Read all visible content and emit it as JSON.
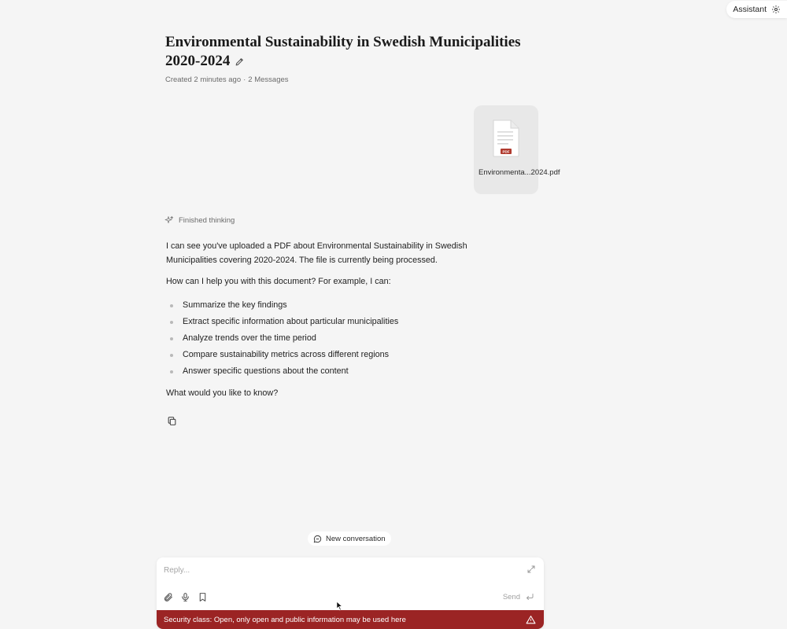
{
  "header": {
    "assistant_label": "Assistant",
    "title": "Environmental Sustainability in Swedish Municipalities 2020-2024",
    "created": "Created 2 minutes ago",
    "separator": "·",
    "messages": "2 Messages"
  },
  "attachment": {
    "filename": "Environmenta...2024.pdf",
    "badge": "PDF"
  },
  "thinking": {
    "label": "Finished thinking"
  },
  "reply": {
    "intro": "I can see you've uploaded a PDF about Environmental Sustainability in Swedish Municipalities covering 2020-2024. The file is currently being processed.",
    "question": "How can I help you with this document? For example, I can:",
    "items": [
      "Summarize the key findings",
      "Extract specific information about particular municipalities",
      "Analyze trends over the time period",
      "Compare sustainability metrics across different regions",
      "Answer specific questions about the content"
    ],
    "closing": "What would you like to know?"
  },
  "new_conversation": {
    "label": "New conversation"
  },
  "composer": {
    "placeholder": "Reply...",
    "send_label": "Send"
  },
  "security": {
    "text": "Security class: Open, only open and public information may be used here"
  },
  "colors": {
    "background": "#f5f5f5",
    "security_bar": "#9b2424",
    "attachment_card": "#e8e8e8",
    "pdf_badge": "#b03a2e"
  },
  "icons": [
    "gear-icon",
    "pencil-icon",
    "pdf-file-icon",
    "sparkle-icon",
    "copy-icon",
    "chat-bubble-icon",
    "expand-icon",
    "paperclip-icon",
    "microphone-icon",
    "bookmark-icon",
    "enter-icon",
    "warning-icon"
  ]
}
